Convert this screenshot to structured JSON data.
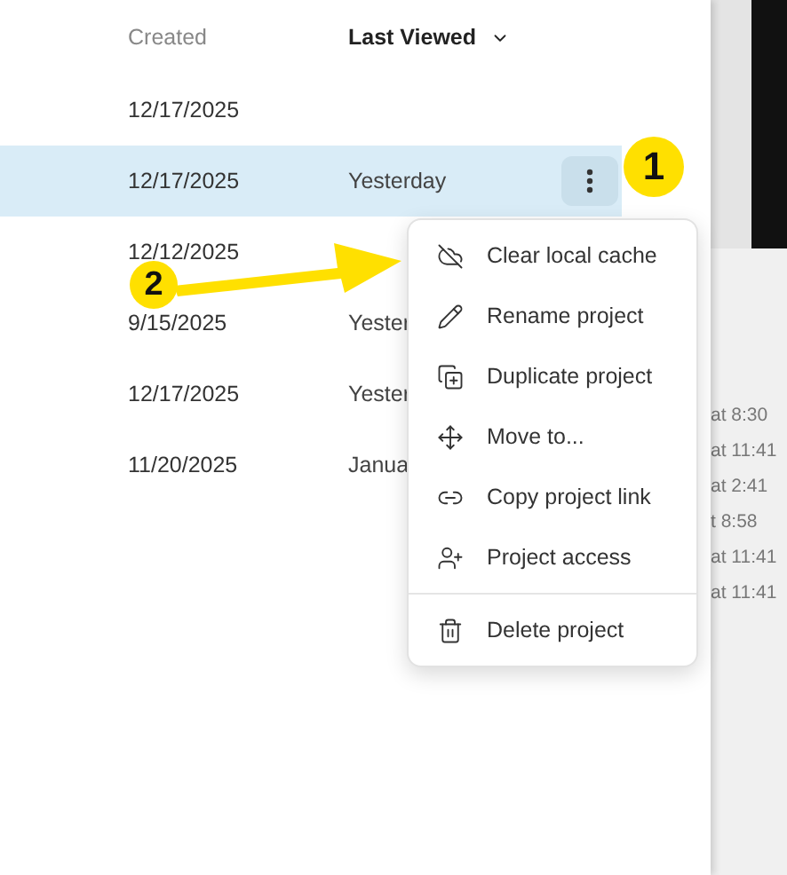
{
  "table": {
    "columns": [
      {
        "label": "Created",
        "sorted": false
      },
      {
        "label": "Last Viewed",
        "sorted": true
      }
    ],
    "rows": [
      {
        "created": "12/17/2025",
        "last_viewed": "",
        "selected": false
      },
      {
        "created": "12/17/2025",
        "last_viewed": "Yesterday",
        "selected": true
      },
      {
        "created": "12/12/2025",
        "last_viewed": "",
        "selected": false
      },
      {
        "created": "9/15/2025",
        "last_viewed": "Yester",
        "selected": false
      },
      {
        "created": "12/17/2025",
        "last_viewed": "Yester",
        "selected": false
      },
      {
        "created": "11/20/2025",
        "last_viewed": "Janua",
        "selected": false
      }
    ]
  },
  "menu": {
    "items": [
      {
        "label": "Clear local cache",
        "divider_before": false
      },
      {
        "label": "Rename project",
        "divider_before": false
      },
      {
        "label": "Duplicate project",
        "divider_before": false
      },
      {
        "label": "Move to...",
        "divider_before": false
      },
      {
        "label": "Copy project link",
        "divider_before": false
      },
      {
        "label": "Project access",
        "divider_before": false
      },
      {
        "label": "Delete project",
        "divider_before": true
      }
    ]
  },
  "annotations": [
    {
      "label": "1"
    },
    {
      "label": "2"
    }
  ],
  "background_window": {
    "times": [
      "at 8:30",
      "at 11:41",
      "at 2:41",
      "t 8:58",
      "at 11:41",
      "at 11:41"
    ]
  }
}
